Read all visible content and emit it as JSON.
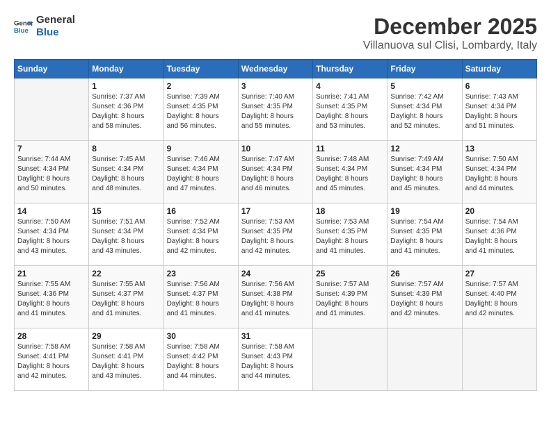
{
  "header": {
    "logo_line1": "General",
    "logo_line2": "Blue",
    "title": "December 2025",
    "subtitle": "Villanuova sul Clisi, Lombardy, Italy"
  },
  "weekdays": [
    "Sunday",
    "Monday",
    "Tuesday",
    "Wednesday",
    "Thursday",
    "Friday",
    "Saturday"
  ],
  "weeks": [
    [
      {
        "day": "",
        "info": ""
      },
      {
        "day": "1",
        "info": "Sunrise: 7:37 AM\nSunset: 4:36 PM\nDaylight: 8 hours\nand 58 minutes."
      },
      {
        "day": "2",
        "info": "Sunrise: 7:39 AM\nSunset: 4:35 PM\nDaylight: 8 hours\nand 56 minutes."
      },
      {
        "day": "3",
        "info": "Sunrise: 7:40 AM\nSunset: 4:35 PM\nDaylight: 8 hours\nand 55 minutes."
      },
      {
        "day": "4",
        "info": "Sunrise: 7:41 AM\nSunset: 4:35 PM\nDaylight: 8 hours\nand 53 minutes."
      },
      {
        "day": "5",
        "info": "Sunrise: 7:42 AM\nSunset: 4:34 PM\nDaylight: 8 hours\nand 52 minutes."
      },
      {
        "day": "6",
        "info": "Sunrise: 7:43 AM\nSunset: 4:34 PM\nDaylight: 8 hours\nand 51 minutes."
      }
    ],
    [
      {
        "day": "7",
        "info": "Sunrise: 7:44 AM\nSunset: 4:34 PM\nDaylight: 8 hours\nand 50 minutes."
      },
      {
        "day": "8",
        "info": "Sunrise: 7:45 AM\nSunset: 4:34 PM\nDaylight: 8 hours\nand 48 minutes."
      },
      {
        "day": "9",
        "info": "Sunrise: 7:46 AM\nSunset: 4:34 PM\nDaylight: 8 hours\nand 47 minutes."
      },
      {
        "day": "10",
        "info": "Sunrise: 7:47 AM\nSunset: 4:34 PM\nDaylight: 8 hours\nand 46 minutes."
      },
      {
        "day": "11",
        "info": "Sunrise: 7:48 AM\nSunset: 4:34 PM\nDaylight: 8 hours\nand 45 minutes."
      },
      {
        "day": "12",
        "info": "Sunrise: 7:49 AM\nSunset: 4:34 PM\nDaylight: 8 hours\nand 45 minutes."
      },
      {
        "day": "13",
        "info": "Sunrise: 7:50 AM\nSunset: 4:34 PM\nDaylight: 8 hours\nand 44 minutes."
      }
    ],
    [
      {
        "day": "14",
        "info": "Sunrise: 7:50 AM\nSunset: 4:34 PM\nDaylight: 8 hours\nand 43 minutes."
      },
      {
        "day": "15",
        "info": "Sunrise: 7:51 AM\nSunset: 4:34 PM\nDaylight: 8 hours\nand 43 minutes."
      },
      {
        "day": "16",
        "info": "Sunrise: 7:52 AM\nSunset: 4:34 PM\nDaylight: 8 hours\nand 42 minutes."
      },
      {
        "day": "17",
        "info": "Sunrise: 7:53 AM\nSunset: 4:35 PM\nDaylight: 8 hours\nand 42 minutes."
      },
      {
        "day": "18",
        "info": "Sunrise: 7:53 AM\nSunset: 4:35 PM\nDaylight: 8 hours\nand 41 minutes."
      },
      {
        "day": "19",
        "info": "Sunrise: 7:54 AM\nSunset: 4:35 PM\nDaylight: 8 hours\nand 41 minutes."
      },
      {
        "day": "20",
        "info": "Sunrise: 7:54 AM\nSunset: 4:36 PM\nDaylight: 8 hours\nand 41 minutes."
      }
    ],
    [
      {
        "day": "21",
        "info": "Sunrise: 7:55 AM\nSunset: 4:36 PM\nDaylight: 8 hours\nand 41 minutes."
      },
      {
        "day": "22",
        "info": "Sunrise: 7:55 AM\nSunset: 4:37 PM\nDaylight: 8 hours\nand 41 minutes."
      },
      {
        "day": "23",
        "info": "Sunrise: 7:56 AM\nSunset: 4:37 PM\nDaylight: 8 hours\nand 41 minutes."
      },
      {
        "day": "24",
        "info": "Sunrise: 7:56 AM\nSunset: 4:38 PM\nDaylight: 8 hours\nand 41 minutes."
      },
      {
        "day": "25",
        "info": "Sunrise: 7:57 AM\nSunset: 4:39 PM\nDaylight: 8 hours\nand 41 minutes."
      },
      {
        "day": "26",
        "info": "Sunrise: 7:57 AM\nSunset: 4:39 PM\nDaylight: 8 hours\nand 42 minutes."
      },
      {
        "day": "27",
        "info": "Sunrise: 7:57 AM\nSunset: 4:40 PM\nDaylight: 8 hours\nand 42 minutes."
      }
    ],
    [
      {
        "day": "28",
        "info": "Sunrise: 7:58 AM\nSunset: 4:41 PM\nDaylight: 8 hours\nand 42 minutes."
      },
      {
        "day": "29",
        "info": "Sunrise: 7:58 AM\nSunset: 4:41 PM\nDaylight: 8 hours\nand 43 minutes."
      },
      {
        "day": "30",
        "info": "Sunrise: 7:58 AM\nSunset: 4:42 PM\nDaylight: 8 hours\nand 44 minutes."
      },
      {
        "day": "31",
        "info": "Sunrise: 7:58 AM\nSunset: 4:43 PM\nDaylight: 8 hours\nand 44 minutes."
      },
      {
        "day": "",
        "info": ""
      },
      {
        "day": "",
        "info": ""
      },
      {
        "day": "",
        "info": ""
      }
    ]
  ]
}
